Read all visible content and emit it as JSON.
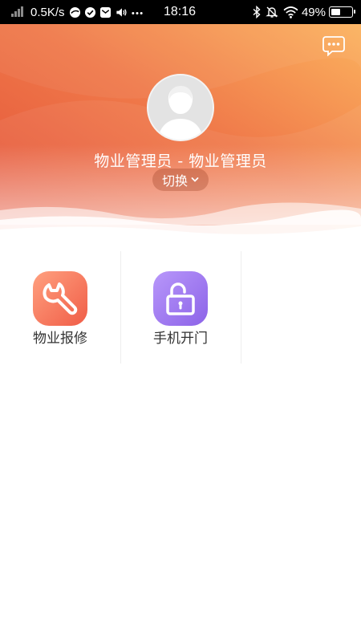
{
  "status_bar": {
    "net_speed": "0.5K/s",
    "time": "18:16",
    "battery": "49%",
    "battery_level": 0.49
  },
  "header": {
    "user_name": "物业管理员 - 物业管理员",
    "switch_label": "切换",
    "icons": {
      "message": "message-icon",
      "avatar": "avatar-placeholder-icon",
      "switch": "chevron-down-icon"
    }
  },
  "grid": {
    "items": [
      {
        "label": "物业报修",
        "icon": "wrench-icon",
        "colors": [
          "#ff9d7a",
          "#f05e48"
        ]
      },
      {
        "label": "手机开门",
        "icon": "unlock-icon",
        "colors": [
          "#b593f8",
          "#8e66ea"
        ]
      }
    ]
  },
  "colors": {
    "header_gradient_start": "#e8563d",
    "header_gradient_end": "#f9a45a"
  }
}
